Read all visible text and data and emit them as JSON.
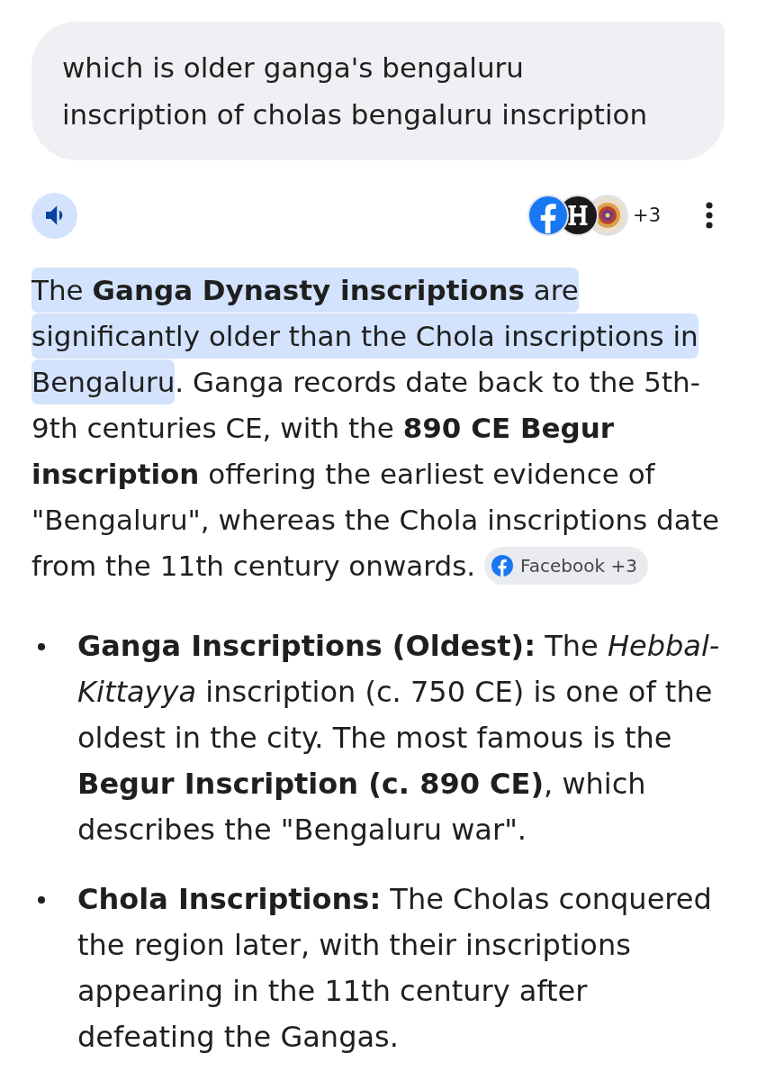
{
  "query": {
    "text": "which is older ganga's bengaluru inscription of cholas bengaluru inscription"
  },
  "toolbar": {
    "source_count": "+3"
  },
  "summary": {
    "parts": [
      {
        "text": "The **Ganga Dynasty inscriptions** are significantly older than the Chola inscriptions in Bengaluru",
        "highlighted": true
      },
      {
        "text": ". Ganga records date back to the 5th-9th centuries CE, with the **890 CE Begur inscription** offering the earliest evidence of \"Bengaluru\", whereas the Chola inscriptions date from the 11th century onwards.",
        "highlighted": false
      }
    ],
    "source_chip": {
      "label": "Facebook +3"
    }
  },
  "bullets": [
    {
      "text": "**Ganga Inscriptions (Oldest):** The *Hebbal-Kittayya* inscription (c. 750 CE) is one of the oldest in the city. The most famous is the **Begur Inscription (c. 890 CE)**, which describes the \"Bengaluru war\"."
    },
    {
      "text": "**Chola Inscriptions:** The Cholas conquered the region later, with their inscriptions appearing in the 11th century after defeating the Gangas."
    }
  ]
}
